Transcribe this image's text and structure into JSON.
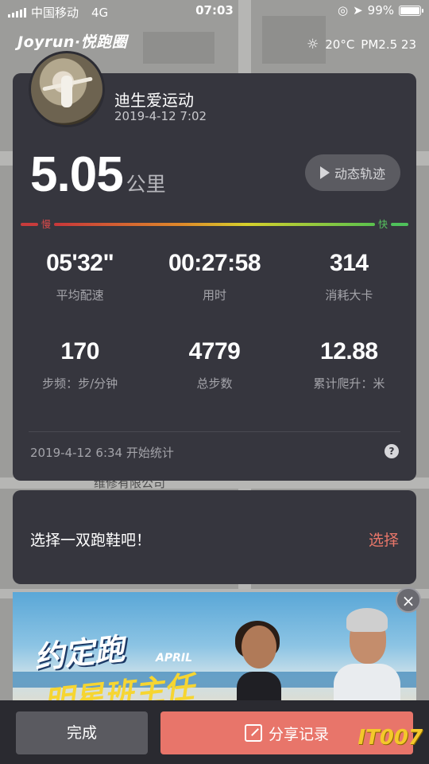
{
  "status_bar": {
    "carrier": "中国移动",
    "network": "4G",
    "time": "07:03",
    "battery": "99%",
    "battery_level": 0.99
  },
  "header": {
    "logo": "Joyrun·悦跑圈",
    "temperature": "20°C",
    "air_quality": "PM2.5 23"
  },
  "map_labels": {
    "company": "维修有限公司"
  },
  "run_card": {
    "user_name": "迪生爱运动",
    "run_date": "2019-4-12 7:02",
    "distance": "5.05",
    "distance_unit": "公里",
    "track_button": "动态轨迹",
    "pace_slow_label": "慢",
    "pace_fast_label": "快",
    "stats": [
      {
        "value": "05'32\"",
        "label": "平均配速"
      },
      {
        "value": "00:27:58",
        "label": "用时"
      },
      {
        "value": "314",
        "label": "消耗大卡"
      },
      {
        "value": "170",
        "label": "步频：步/分钟"
      },
      {
        "value": "4779",
        "label": "总步数"
      },
      {
        "value": "12.88",
        "label": "累计爬升：米"
      }
    ],
    "start_time_text": "2019-4-12 6:34 开始统计",
    "help_label": "?"
  },
  "shoe_card": {
    "prompt": "选择一双跑鞋吧！",
    "select_label": "选择"
  },
  "ad": {
    "title_line1": "约定跑",
    "title_line2": "明星班主任",
    "month": "APRIL",
    "close_label": "×"
  },
  "bottom_bar": {
    "done_label": "完成",
    "share_label": "分享记录"
  },
  "watermark": "IT007",
  "colors": {
    "card_bg": "#36363e",
    "accent": "#e8756a",
    "slow": "#c83c3c",
    "fast": "#4fc15b"
  }
}
